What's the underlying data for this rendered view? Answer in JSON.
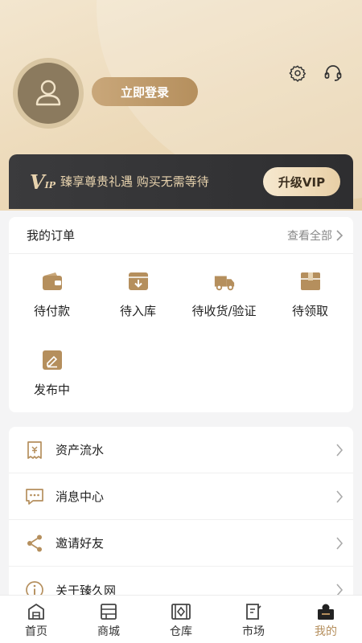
{
  "header": {
    "login_label": "立即登录",
    "settings_icon": "gear-icon",
    "service_icon": "headset-icon"
  },
  "vip": {
    "logo_v": "V",
    "logo_ip": "IP",
    "text": "臻享尊贵礼遇  购买无需等待",
    "button_label": "升级VIP"
  },
  "orders": {
    "title": "我的订单",
    "view_all": "查看全部",
    "items": [
      {
        "label": "待付款",
        "icon": "wallet-icon"
      },
      {
        "label": "待入库",
        "icon": "inbox-icon"
      },
      {
        "label": "待收货/验证",
        "icon": "truck-icon"
      },
      {
        "label": "待领取",
        "icon": "package-icon"
      },
      {
        "label": "发布中",
        "icon": "edit-icon"
      }
    ]
  },
  "menu": {
    "items": [
      {
        "label": "资产流水",
        "icon": "receipt-icon"
      },
      {
        "label": "消息中心",
        "icon": "message-icon"
      },
      {
        "label": "邀请好友",
        "icon": "share-icon"
      },
      {
        "label": "关于臻久网",
        "icon": "info-icon"
      }
    ]
  },
  "tabs": [
    {
      "label": "首页",
      "icon": "home-icon"
    },
    {
      "label": "商城",
      "icon": "mall-icon"
    },
    {
      "label": "仓库",
      "icon": "warehouse-icon"
    },
    {
      "label": "市场",
      "icon": "market-icon"
    },
    {
      "label": "我的",
      "icon": "profile-icon",
      "active": true
    }
  ],
  "colors": {
    "accent": "#b58f5d",
    "accent_light": "#c9a77a",
    "vip_bar": "#333335",
    "vip_text": "#e8d3ae"
  }
}
